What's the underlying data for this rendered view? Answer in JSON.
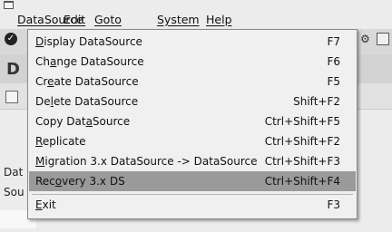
{
  "menubar": {
    "items": [
      {
        "label": "DataSource"
      },
      {
        "label": "Edit"
      },
      {
        "label": "Goto"
      },
      {
        "label": "System"
      },
      {
        "label": "Help"
      }
    ]
  },
  "background": {
    "title_fragment": "D",
    "row1_fragment": "Dat",
    "row2_fragment": "Sou"
  },
  "dropdown": {
    "items": [
      {
        "pre": "",
        "u": "D",
        "post": "isplay DataSource",
        "shortcut": "F7"
      },
      {
        "pre": "Ch",
        "u": "a",
        "post": "nge DataSource",
        "shortcut": "F6"
      },
      {
        "pre": "Cr",
        "u": "e",
        "post": "ate DataSource",
        "shortcut": "F5"
      },
      {
        "pre": "De",
        "u": "l",
        "post": "ete DataSource",
        "shortcut": "Shift+F2"
      },
      {
        "pre": "Copy Dat",
        "u": "a",
        "post": "Source",
        "shortcut": "Ctrl+Shift+F5"
      },
      {
        "pre": "",
        "u": "R",
        "post": "eplicate",
        "shortcut": "Ctrl+Shift+F2"
      },
      {
        "pre": "",
        "u": "M",
        "post": "igration 3.x DataSource -> DataSource",
        "shortcut": "Ctrl+Shift+F3"
      },
      {
        "pre": "Rec",
        "u": "o",
        "post": "very 3.x DS",
        "shortcut": "Ctrl+Shift+F4"
      },
      {
        "pre": "",
        "u": "E",
        "post": "xit",
        "shortcut": "F3"
      }
    ]
  }
}
